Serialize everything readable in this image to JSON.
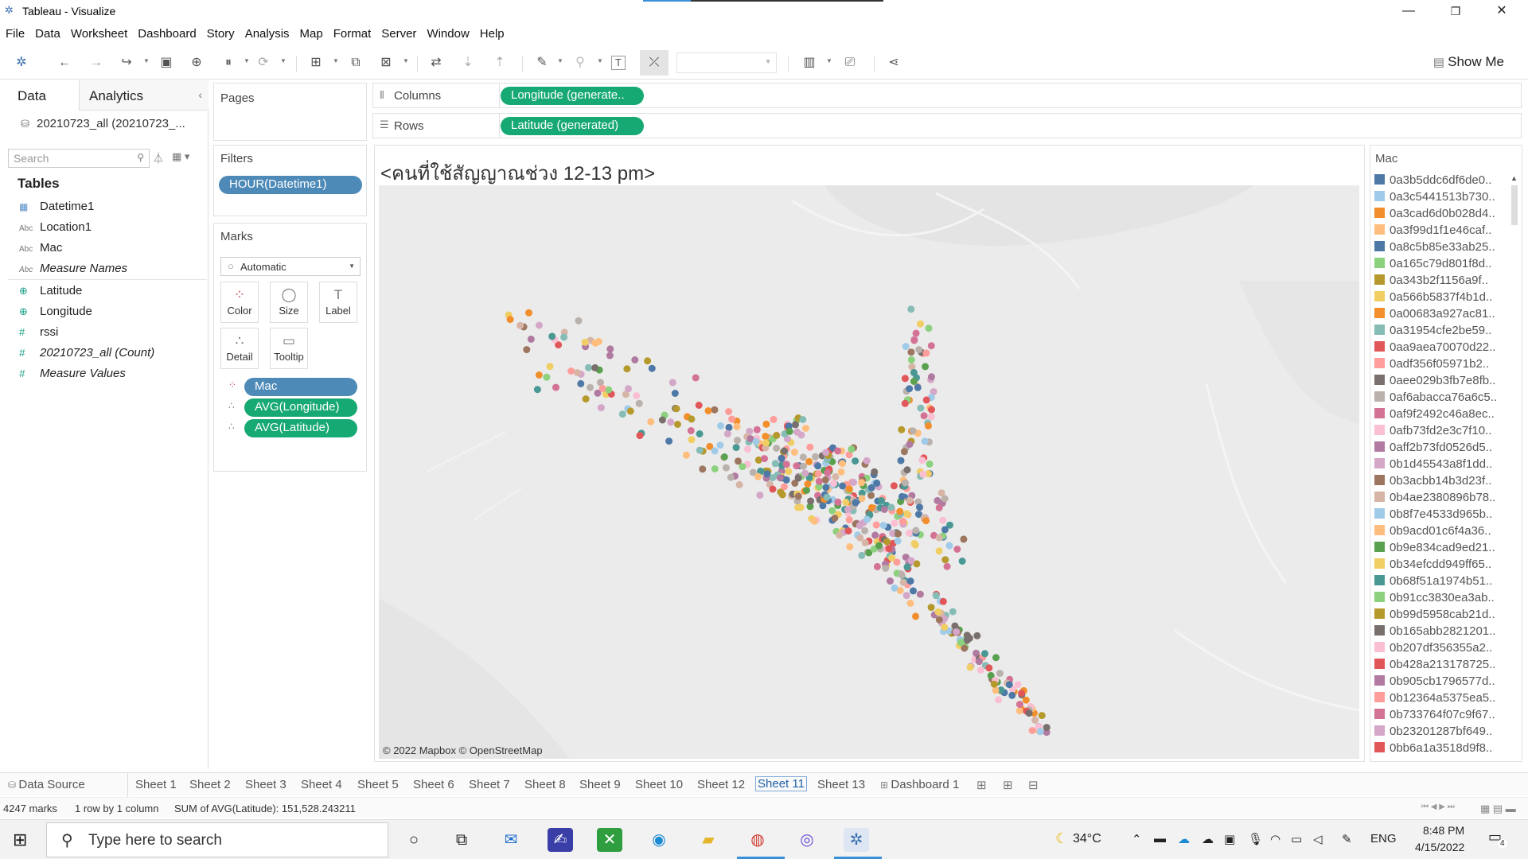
{
  "window": {
    "title": "Tableau - Visualize",
    "controls": [
      "—",
      "❐",
      "✕"
    ]
  },
  "menu": [
    "File",
    "Data",
    "Worksheet",
    "Dashboard",
    "Story",
    "Analysis",
    "Map",
    "Format",
    "Server",
    "Window",
    "Help"
  ],
  "toolbar": {
    "show_me": "Show Me",
    "icons": [
      "tableau-logo-icon",
      "undo-icon",
      "redo-icon",
      "forward-icon",
      "save-icon",
      "new-datasource-icon",
      "pause-icon",
      "refresh-icon",
      "new-worksheet-icon",
      "duplicate-icon",
      "clear-icon",
      "swap-icon",
      "sort-asc-icon",
      "sort-desc-icon",
      "highlight-icon",
      "group-icon",
      "label-icon",
      "fix-axes-icon",
      "fit-dropdown",
      "show-cards-icon",
      "presentation-icon",
      "share-icon"
    ]
  },
  "data_pane": {
    "tab_data": "Data",
    "tab_analytics": "Analytics",
    "datasource": "20210723_all (20210723_...",
    "search_placeholder": "Search",
    "tables_heading": "Tables",
    "fields": [
      {
        "name": "Datetime1",
        "type": "date",
        "italic": false
      },
      {
        "name": "Location1",
        "type": "abc",
        "italic": false
      },
      {
        "name": "Mac",
        "type": "abc",
        "italic": false
      },
      {
        "name": "Measure Names",
        "type": "abc",
        "italic": true
      },
      {
        "name": "Latitude",
        "type": "geo",
        "italic": false
      },
      {
        "name": "Longitude",
        "type": "geo",
        "italic": false
      },
      {
        "name": "rssi",
        "type": "num",
        "italic": false
      },
      {
        "name": "20210723_all (Count)",
        "type": "num",
        "italic": true
      },
      {
        "name": "Measure Values",
        "type": "num",
        "italic": true
      }
    ]
  },
  "shelves": {
    "pages_label": "Pages",
    "filters_label": "Filters",
    "filter_pill": "HOUR(Datetime1)",
    "marks_label": "Marks",
    "mark_type": "Automatic",
    "mark_buttons": [
      {
        "label": "Color",
        "glyph": "⁘"
      },
      {
        "label": "Size",
        "glyph": "◯"
      },
      {
        "label": "Label",
        "glyph": "T"
      },
      {
        "label": "Detail",
        "glyph": "∴"
      },
      {
        "label": "Tooltip",
        "glyph": "▭"
      }
    ],
    "marks_pills": [
      "Mac",
      "AVG(Longitude)",
      "AVG(Latitude)"
    ],
    "columns_label": "Columns",
    "columns_pill": "Longitude (generate..",
    "rows_label": "Rows",
    "rows_pill": "Latitude (generated)"
  },
  "view": {
    "title": "<คนที่ใช้สัญญาณช่วง 12-13 pm>",
    "credit": "© 2022 Mapbox © OpenStreetMap"
  },
  "legend": {
    "title": "Mac",
    "items": [
      {
        "label": "0a3b5ddc6df6de0..",
        "color": "#4e79a7"
      },
      {
        "label": "0a3c5441513b730..",
        "color": "#a0cbe8"
      },
      {
        "label": "0a3cad6d0b028d4..",
        "color": "#f28e2b"
      },
      {
        "label": "0a3f99d1f1e46caf..",
        "color": "#ffbe7d"
      },
      {
        "label": "0a8c5b85e33ab25..",
        "color": "#4e79a7"
      },
      {
        "label": "0a165c79d801f8d..",
        "color": "#8cd17d"
      },
      {
        "label": "0a343b2f1156a9f..",
        "color": "#b6992d"
      },
      {
        "label": "0a566b5837f4b1d..",
        "color": "#f1ce63"
      },
      {
        "label": "0a00683a927ac81..",
        "color": "#f28e2b"
      },
      {
        "label": "0a31954cfe2be59..",
        "color": "#86bcb6"
      },
      {
        "label": "0aa9aea70070d22..",
        "color": "#e15759"
      },
      {
        "label": "0adf356f05971b2..",
        "color": "#ff9d9a"
      },
      {
        "label": "0aee029b3fb7e8fb..",
        "color": "#79706e"
      },
      {
        "label": "0af6abacca76a6c5..",
        "color": "#bab0ac"
      },
      {
        "label": "0af9f2492c46a8ec..",
        "color": "#d37295"
      },
      {
        "label": "0afb73fd2e3c7f10..",
        "color": "#fabfd2"
      },
      {
        "label": "0aff2b73fd0526d5..",
        "color": "#b07aa1"
      },
      {
        "label": "0b1d45543a8f1dd..",
        "color": "#d4a6c8"
      },
      {
        "label": "0b3acbb14b3d23f..",
        "color": "#9d7660"
      },
      {
        "label": "0b4ae2380896b78..",
        "color": "#d7b5a6"
      },
      {
        "label": "0b8f7e4533d965b..",
        "color": "#a0cbe8"
      },
      {
        "label": "0b9acd01c6f4a36..",
        "color": "#ffbe7d"
      },
      {
        "label": "0b9e834cad9ed21..",
        "color": "#59a14f"
      },
      {
        "label": "0b34efcdd949ff65..",
        "color": "#f1ce63"
      },
      {
        "label": "0b68f51a1974b51..",
        "color": "#499894"
      },
      {
        "label": "0b91cc3830ea3ab..",
        "color": "#8cd17d"
      },
      {
        "label": "0b99d5958cab21d..",
        "color": "#b6992d"
      },
      {
        "label": "0b165abb2821201..",
        "color": "#79706e"
      },
      {
        "label": "0b207df356355a2..",
        "color": "#fabfd2"
      },
      {
        "label": "0b428a213178725..",
        "color": "#e15759"
      },
      {
        "label": "0b905cb1796577d..",
        "color": "#b07aa1"
      },
      {
        "label": "0b12364a5375ea5..",
        "color": "#ff9d9a"
      },
      {
        "label": "0b733764f07c9f67..",
        "color": "#d37295"
      },
      {
        "label": "0b23201287bf649..",
        "color": "#d4a6c8"
      },
      {
        "label": "0bb6a1a3518d9f8..",
        "color": "#e15759"
      }
    ]
  },
  "sheet_tabs": {
    "data_source": "Data Source",
    "sheets": [
      "Sheet 1",
      "Sheet 2",
      "Sheet 3",
      "Sheet 4",
      "Sheet 5",
      "Sheet 6",
      "Sheet 7",
      "Sheet 8",
      "Sheet 9",
      "Sheet 10",
      "Sheet 12",
      "Sheet 11",
      "Sheet 13",
      "Dashboard 1"
    ],
    "active": "Sheet 11"
  },
  "status": {
    "marks": "4247 marks",
    "dims": "1 row by 1 column",
    "sum": "SUM of AVG(Latitude): 151,528.243211"
  },
  "taskbar": {
    "search_placeholder": "Type here to search",
    "temperature": "34°C",
    "language": "ENG",
    "time": "8:48 PM",
    "date": "4/15/2022",
    "notifications": "4"
  },
  "colors": {
    "pill_blue": "#4e8ab8",
    "pill_green": "#17a973",
    "map_bg": "#ebebeb",
    "palette": [
      "#4e79a7",
      "#a0cbe8",
      "#f28e2b",
      "#ffbe7d",
      "#59a14f",
      "#8cd17d",
      "#b6992d",
      "#f1ce63",
      "#499894",
      "#86bcb6",
      "#e15759",
      "#ff9d9a",
      "#79706e",
      "#bab0ac",
      "#d37295",
      "#fabfd2",
      "#b07aa1",
      "#d4a6c8",
      "#9d7660",
      "#d7b5a6"
    ]
  }
}
